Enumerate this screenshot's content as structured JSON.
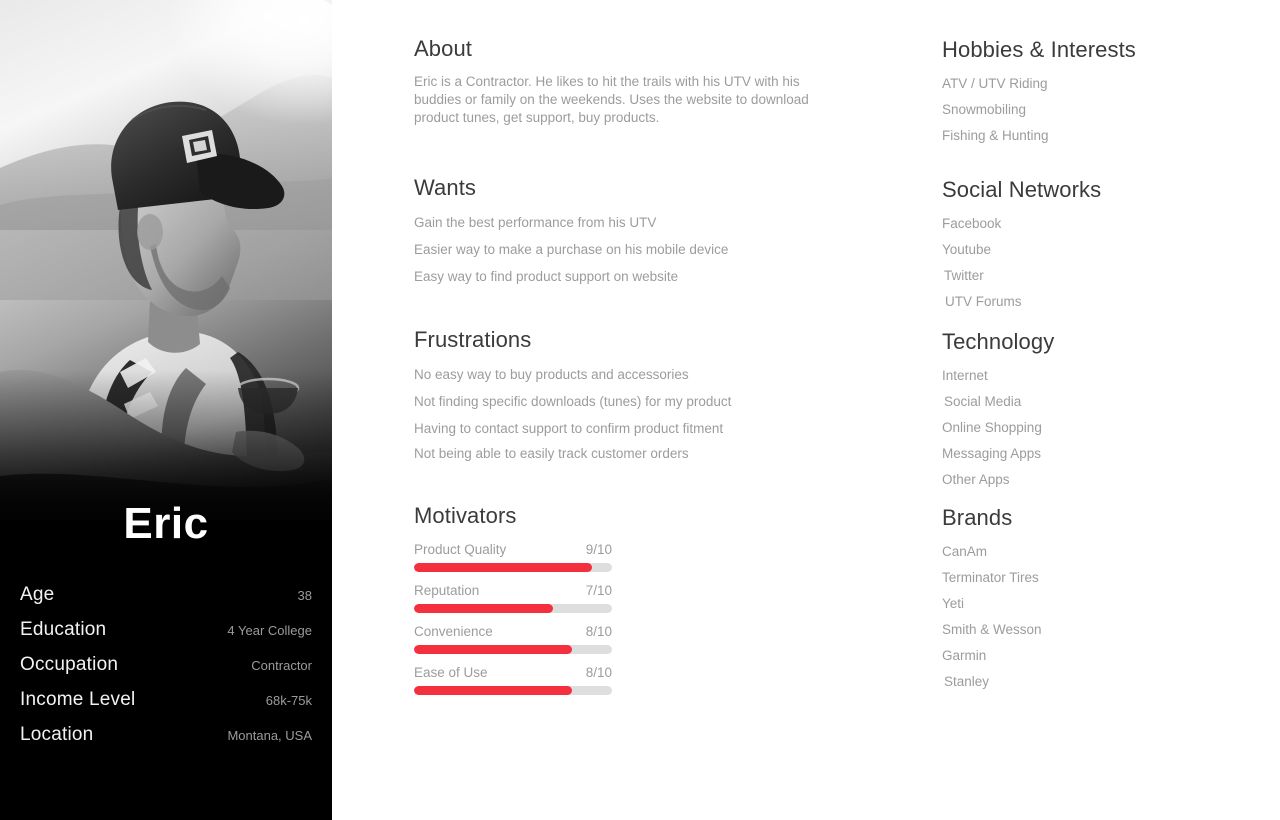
{
  "persona": {
    "name": "Eric",
    "photo": {
      "description": "black-and-white photo of bearded man in baseball cap leaning on a UTV at sunset"
    },
    "demographics": [
      {
        "label": "Age",
        "value": "38"
      },
      {
        "label": "Education",
        "value": "4 Year College"
      },
      {
        "label": "Occupation",
        "value": "Contractor"
      },
      {
        "label": "Income Level",
        "value": "68k-75k"
      },
      {
        "label": "Location",
        "value": "Montana, USA"
      }
    ]
  },
  "about": {
    "title": "About",
    "text": "Eric is a Contractor.  He likes to hit the trails with his UTV with his buddies or family on the weekends.  Uses the website to download product tunes, get support, buy products."
  },
  "wants": {
    "title": "Wants",
    "items": [
      "Gain the best performance from his UTV",
      "Easier way to make a purchase on his mobile device",
      "Easy way to find product support on website"
    ]
  },
  "frustrations": {
    "title": "Frustrations",
    "items": [
      "No easy way to buy products and accessories",
      "Not finding specific downloads (tunes) for my product",
      "Having to contact support to confirm product fitment",
      "Not being able to easily track customer orders"
    ]
  },
  "motivators": {
    "title": "Motivators",
    "max": 10,
    "items": [
      {
        "label": "Product Quality",
        "score": 9,
        "score_text": "9/10"
      },
      {
        "label": "Reputation",
        "score": 7,
        "score_text": "7/10"
      },
      {
        "label": "Convenience",
        "score": 8,
        "score_text": "8/10"
      },
      {
        "label": "Ease of Use",
        "score": 8,
        "score_text": "8/10"
      }
    ]
  },
  "hobbies": {
    "title": "Hobbies & Interests",
    "items": [
      "ATV / UTV Riding",
      "Snowmobiling",
      "Fishing & Hunting"
    ]
  },
  "social_networks": {
    "title": "Social Networks",
    "items": [
      "Facebook",
      "Youtube",
      "Twitter",
      "UTV Forums"
    ]
  },
  "technology": {
    "title": "Technology",
    "items": [
      "Internet",
      "Social Media",
      "Online Shopping",
      "Messaging Apps",
      "Other Apps"
    ]
  },
  "brands": {
    "title": "Brands",
    "items": [
      "CanAm",
      "Terminator Tires",
      "Yeti",
      "Smith & Wesson",
      "Garmin",
      "Stanley"
    ]
  },
  "colors": {
    "accent_red": "#f4303e",
    "track_gray": "#dedede",
    "sidebar_bg": "#000000",
    "heading": "#3b3b3b",
    "body": "#9c9c9c",
    "page_bg": "#ffffff"
  }
}
